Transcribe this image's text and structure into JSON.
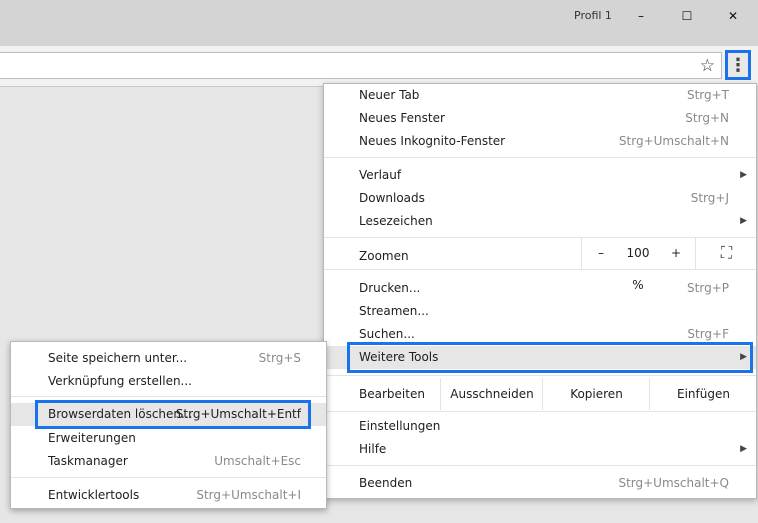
{
  "window": {
    "profile": "Profil 1",
    "minimize": "–",
    "maximize": "☐",
    "close": "✕"
  },
  "toolbar": {
    "star": "☆",
    "menu": "⋮"
  },
  "menu": {
    "new_tab": {
      "label": "Neuer Tab",
      "shortcut": "Strg+T"
    },
    "new_window": {
      "label": "Neues Fenster",
      "shortcut": "Strg+N"
    },
    "incognito": {
      "label": "Neues Inkognito-Fenster",
      "shortcut": "Strg+Umschalt+N"
    },
    "history": {
      "label": "Verlauf"
    },
    "downloads": {
      "label": "Downloads",
      "shortcut": "Strg+J"
    },
    "bookmarks": {
      "label": "Lesezeichen"
    },
    "zoom": {
      "label": "Zoomen",
      "minus": "–",
      "value": "100 %",
      "plus": "+",
      "fullscreen": "⛶"
    },
    "print": {
      "label": "Drucken...",
      "shortcut": "Strg+P"
    },
    "cast": {
      "label": "Streamen..."
    },
    "find": {
      "label": "Suchen...",
      "shortcut": "Strg+F"
    },
    "more_tools": {
      "label": "Weitere Tools"
    },
    "edit": {
      "label": "Bearbeiten",
      "cut": "Ausschneiden",
      "copy": "Kopieren",
      "paste": "Einfügen"
    },
    "settings": {
      "label": "Einstellungen"
    },
    "help": {
      "label": "Hilfe"
    },
    "exit": {
      "label": "Beenden",
      "shortcut": "Strg+Umschalt+Q"
    },
    "arrow": "▶"
  },
  "submenu": {
    "save_page": {
      "label": "Seite speichern unter...",
      "shortcut": "Strg+S"
    },
    "create_shortcut": {
      "label": "Verknüpfung erstellen..."
    },
    "clear_data": {
      "label": "Browserdaten löschen...",
      "shortcut": "Strg+Umschalt+Entf"
    },
    "extensions": {
      "label": "Erweiterungen"
    },
    "task_manager": {
      "label": "Taskmanager",
      "shortcut": "Umschalt+Esc"
    },
    "dev_tools": {
      "label": "Entwicklertools",
      "shortcut": "Strg+Umschalt+I"
    }
  },
  "colors": {
    "highlight_border": "#1a73e8",
    "hover": "#e6e6e6"
  }
}
